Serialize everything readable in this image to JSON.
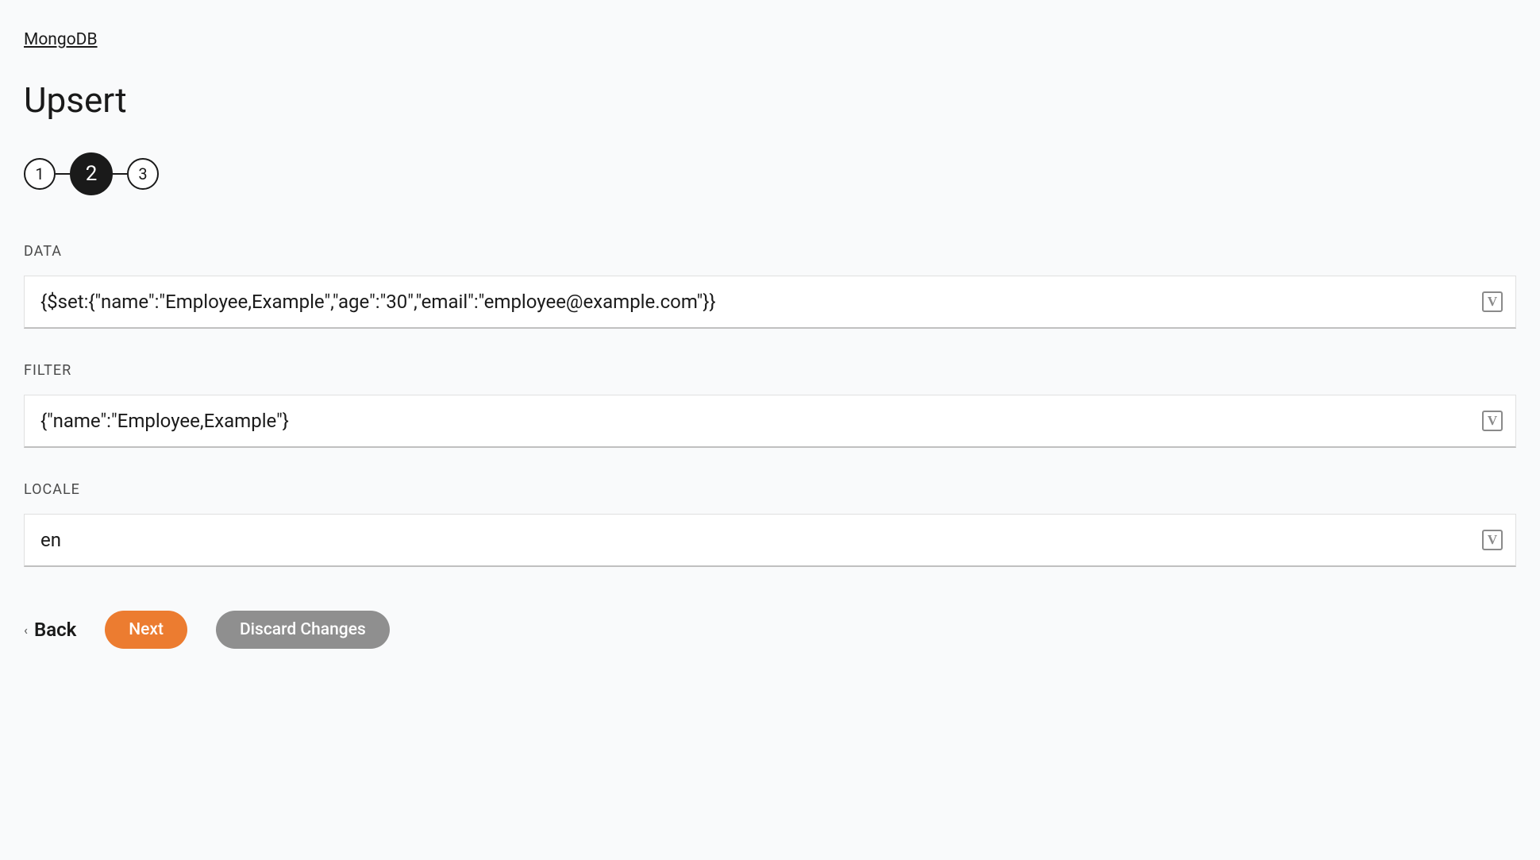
{
  "breadcrumb": {
    "label": "MongoDB"
  },
  "page": {
    "title": "Upsert"
  },
  "stepper": {
    "steps": [
      "1",
      "2",
      "3"
    ],
    "active_index": 1
  },
  "fields": {
    "data": {
      "label": "DATA",
      "value": "{$set:{\"name\":\"Employee,Example\",\"age\":\"30\",\"email\":\"employee@example.com\"}}"
    },
    "filter": {
      "label": "FILTER",
      "value": "{\"name\":\"Employee,Example\"}"
    },
    "locale": {
      "label": "LOCALE",
      "value": "en"
    }
  },
  "icons": {
    "variable": "V"
  },
  "actions": {
    "back": "Back",
    "next": "Next",
    "discard": "Discard Changes"
  }
}
